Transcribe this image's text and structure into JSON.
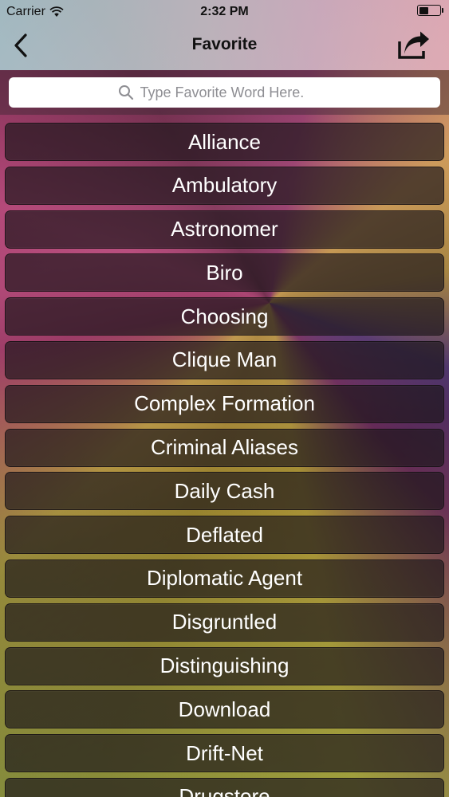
{
  "status_bar": {
    "carrier": "Carrier",
    "time": "2:32 PM"
  },
  "nav": {
    "title": "Favorite"
  },
  "search": {
    "placeholder": "Type Favorite Word Here."
  },
  "words": [
    "Alliance",
    "Ambulatory",
    "Astronomer",
    "Biro",
    "Choosing",
    "Clique Man",
    "Complex Formation",
    "Criminal Aliases",
    "Daily Cash",
    "Deflated",
    "Diplomatic Agent",
    "Disgruntled",
    "Distinguishing",
    "Download",
    "Drift-Net",
    "Drugstore"
  ],
  "icons": {
    "back": "chevron-left-icon",
    "share": "share-icon",
    "search": "search-icon",
    "wifi": "wifi-icon",
    "battery": "battery-icon"
  }
}
